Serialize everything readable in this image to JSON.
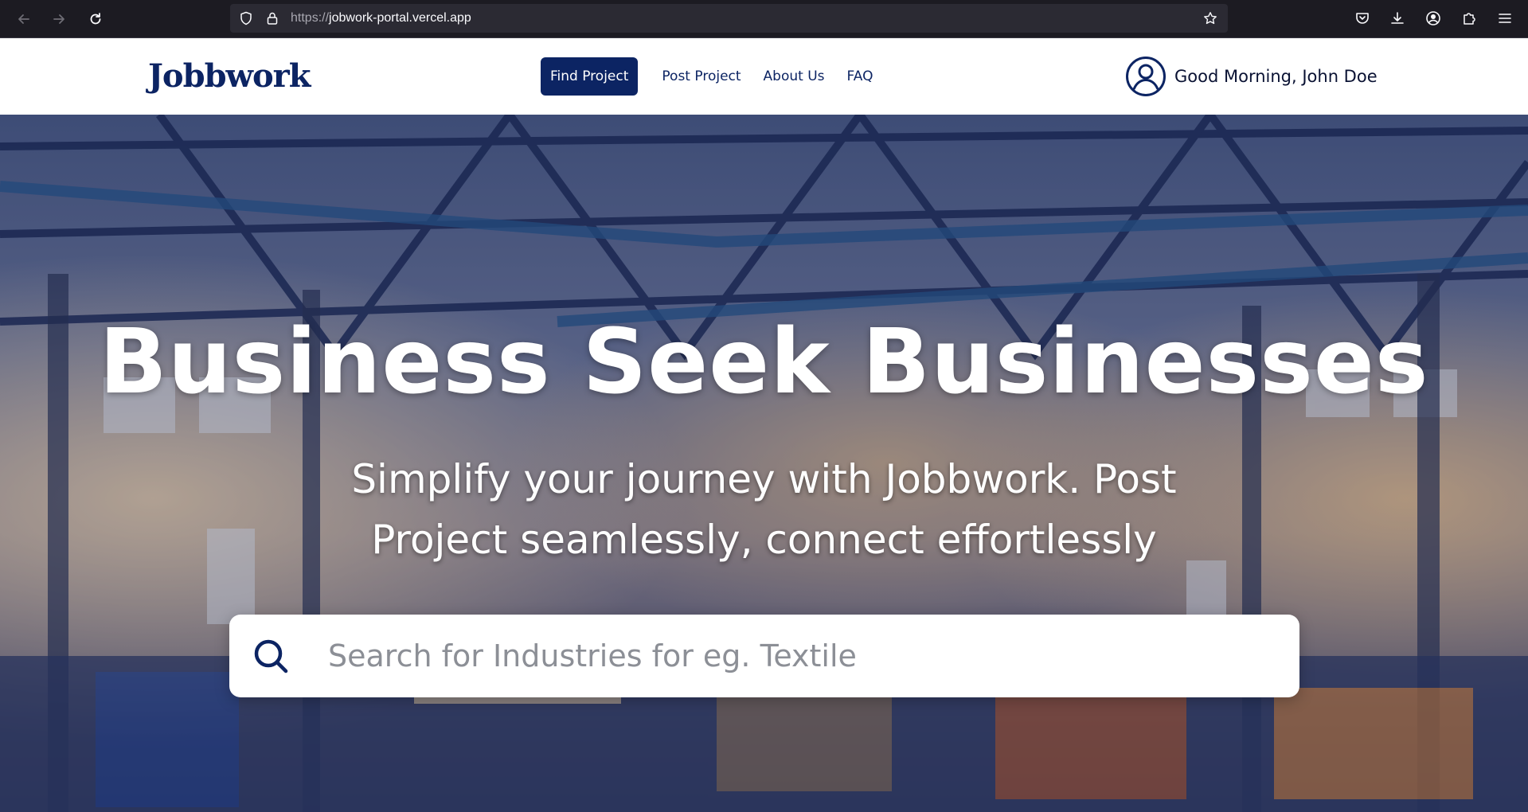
{
  "browser": {
    "url_scheme": "https://",
    "url_host": "jobwork-portal.vercel.app",
    "icons": [
      "back-icon",
      "forward-icon",
      "reload-icon",
      "shield-icon",
      "lock-icon",
      "bookmark-star-icon",
      "pocket-icon",
      "download-icon",
      "account-icon",
      "extensions-icon",
      "menu-icon"
    ]
  },
  "header": {
    "logo": "Jobbwork",
    "nav": [
      {
        "label": "Find Project",
        "active": true
      },
      {
        "label": "Post Project",
        "active": false
      },
      {
        "label": "About Us",
        "active": false
      },
      {
        "label": "FAQ",
        "active": false
      }
    ],
    "greeting": "Good Morning, John Doe"
  },
  "hero": {
    "title": "Business Seek Businesses",
    "subtitle": "Simplify your journey with Jobbwork. Post Project seamlessly, connect effortlessly",
    "search_placeholder": "Search for Industries for eg. Textile",
    "search_value": ""
  },
  "colors": {
    "brand": "#0c2463",
    "chrome_bg": "#1c1b22",
    "urlbar_bg": "#2b2a33",
    "header_bg": "#ffffff"
  }
}
